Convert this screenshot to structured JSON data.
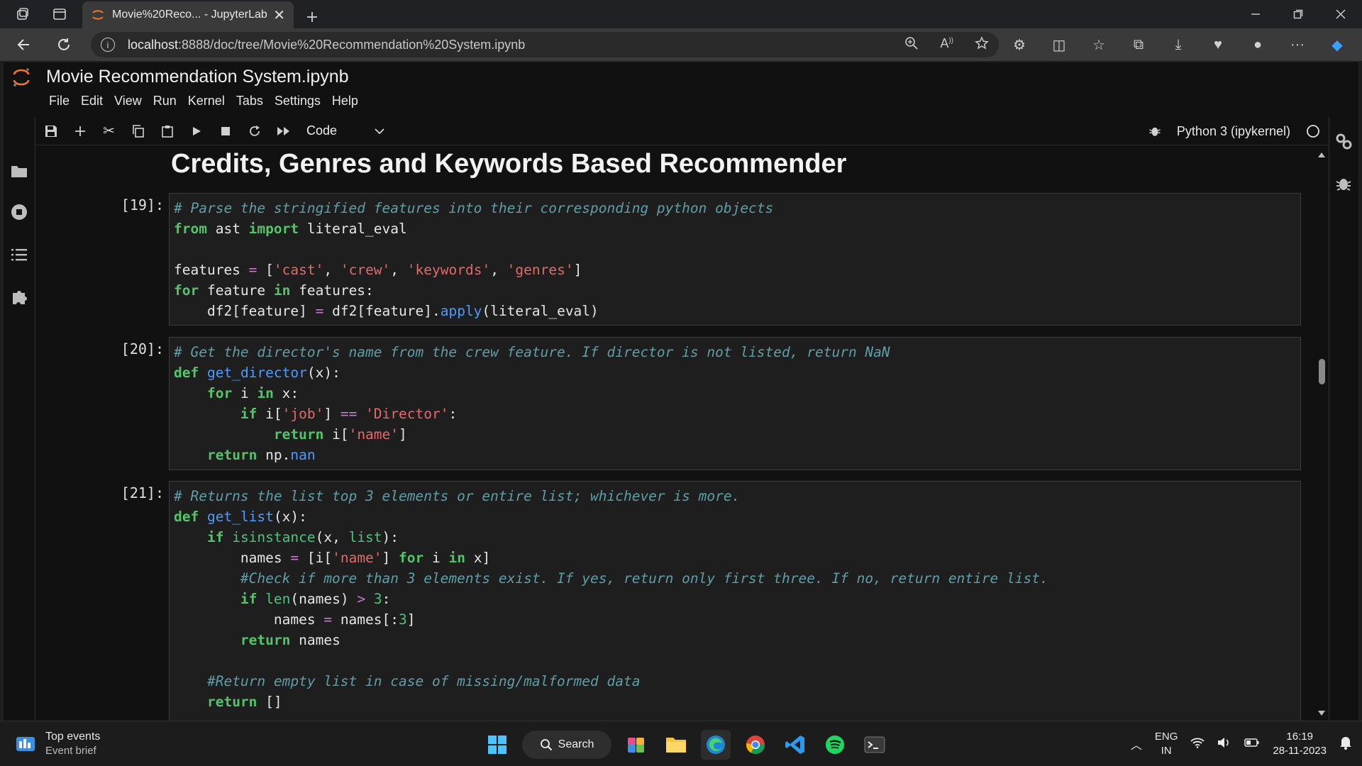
{
  "browser": {
    "tab_title": "Movie%20Reco... - JupyterLab",
    "url_host": "localhost",
    "url_path": ":8888/doc/tree/Movie%20Recommendation%20System.ipynb"
  },
  "jupyter": {
    "doc_title": "Movie Recommendation System.ipynb",
    "menu": [
      "File",
      "Edit",
      "View",
      "Run",
      "Kernel",
      "Tabs",
      "Settings",
      "Help"
    ],
    "cell_type": "Code",
    "kernel_name": "Python 3 (ipykernel)",
    "heading": "Credits, Genres and Keywords Based Recommender",
    "prompts": [
      "[19]:",
      "[20]:",
      "[21]:"
    ]
  },
  "taskbar": {
    "widget_title": "Top events",
    "widget_sub": "Event brief",
    "search_label": "Search",
    "lang_1": "ENG",
    "lang_2": "IN",
    "time": "16:19",
    "date": "28-11-2023"
  },
  "colors": {
    "jupyter_orange": "#f37726",
    "comment": "#5f9ea6",
    "keyword": "#54c46b",
    "string": "#e26a6a",
    "function": "#4e9bff"
  }
}
